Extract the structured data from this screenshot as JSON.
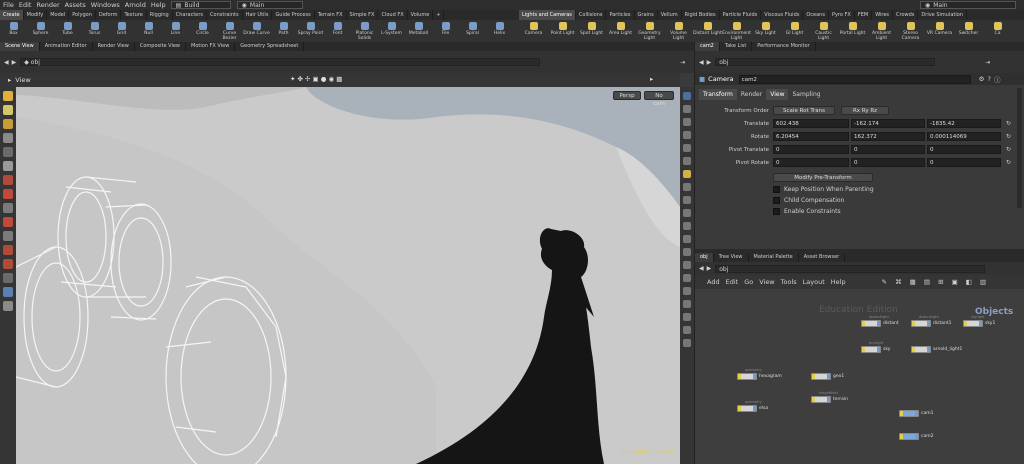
{
  "menubar": {
    "items": [
      "File",
      "Edit",
      "Render",
      "Assets",
      "Windows",
      "Arnold",
      "Help"
    ],
    "desktop": "Build",
    "main_left": "Main",
    "main_right": "Main"
  },
  "shelf_tabs_left": [
    "Create",
    "Modify",
    "Model",
    "Polygon",
    "Deform",
    "Texture",
    "Rigging",
    "Characters",
    "Constraints",
    "Hair Utils",
    "Guide Process",
    "Terrain FX",
    "Simple FX",
    "Cloud FX",
    "Volume"
  ],
  "shelf_tabs_right": [
    "Lights and Cameras",
    "Collisions",
    "Particles",
    "Grains",
    "Vellum",
    "Rigid Bodies",
    "Particle Fluids",
    "Viscous Fluids",
    "Oceans",
    "Pyro FX",
    "FEM",
    "Wires",
    "Crowds",
    "Drive Simulation"
  ],
  "tools_left": [
    "Box",
    "Sphere",
    "Tube",
    "Torus",
    "Grid",
    "Null",
    "Line",
    "Circle",
    "Curve Bezier",
    "Draw Curve",
    "Path",
    "Spray Paint",
    "Font",
    "Platonic Solids",
    "L-System",
    "Metaball",
    "File",
    "Spiral",
    "Helix"
  ],
  "tools_right": [
    "Camera",
    "Point Light",
    "Spot Light",
    "Area Light",
    "Geometry Light",
    "Volume Light",
    "Distant Light",
    "Environment Light",
    "Sky Light",
    "GI Light",
    "Caustic Light",
    "Portal Light",
    "Ambient Light",
    "Stereo Camera",
    "VR Camera",
    "Switcher",
    "Ca"
  ],
  "colors": {
    "tool_left": "#7a9cc6",
    "tool_right": "#e0c35a",
    "accent": "#e3d04a"
  },
  "left_pane_tabs": [
    "Scene View",
    "Animation Editor",
    "Render View",
    "Composite View",
    "Motion FX View",
    "Geometry Spreadsheet"
  ],
  "left_path": "obj",
  "viewport": {
    "title": "View",
    "persp": "Persp",
    "cam": "No cam",
    "watermark": "Education Edition"
  },
  "param_pane": {
    "tabs": [
      "cam2",
      "Take List",
      "Performance Monitor"
    ],
    "path": "obj",
    "node_type": "Camera",
    "node_name": "cam2",
    "sub_tabs": [
      "Transform",
      "Render",
      "View",
      "Sampling"
    ],
    "transform_order_label": "Transform Order",
    "transform_order_value": "Scale Rot Trans",
    "rot_order_value": "Rx Ry Rz",
    "rows": [
      {
        "label": "Translate",
        "v": [
          "602.438",
          "-162.174",
          "-1835.42"
        ]
      },
      {
        "label": "Rotate",
        "v": [
          "6.20454",
          "162.372",
          "0.000114069"
        ]
      },
      {
        "label": "Pivot Translate",
        "v": [
          "0",
          "0",
          "0"
        ]
      },
      {
        "label": "Pivot Rotate",
        "v": [
          "0",
          "0",
          "0"
        ]
      }
    ],
    "modify_button": "Modify Pre-Transform",
    "checks": [
      "Keep Position When Parenting",
      "Child Compensation",
      "Enable Constraints"
    ]
  },
  "network_pane": {
    "tabs": [
      "obj",
      "Tree View",
      "Material Palette",
      "Asset Browser"
    ],
    "path": "obj",
    "menu": [
      "Add",
      "Edit",
      "Go",
      "View",
      "Tools",
      "Layout",
      "Help"
    ],
    "watermark": "Education Edition",
    "context": "Objects",
    "nodes": [
      {
        "name": "distant",
        "sub": "distantlight"
      },
      {
        "name": "distant1",
        "sub": "distantlight"
      },
      {
        "name": "sky1",
        "sub": "skylight"
      },
      {
        "name": "sky",
        "sub": "envlight"
      },
      {
        "name": "arnold_light1",
        "sub": ""
      },
      {
        "name": "hexagram",
        "sub": "geometry"
      },
      {
        "name": "geo1",
        "sub": ""
      },
      {
        "name": "terrain",
        "sub": "heightfield"
      },
      {
        "name": "elsa",
        "sub": "geometry"
      },
      {
        "name": "cam1",
        "sub": ""
      },
      {
        "name": "cam2",
        "sub": ""
      }
    ]
  }
}
